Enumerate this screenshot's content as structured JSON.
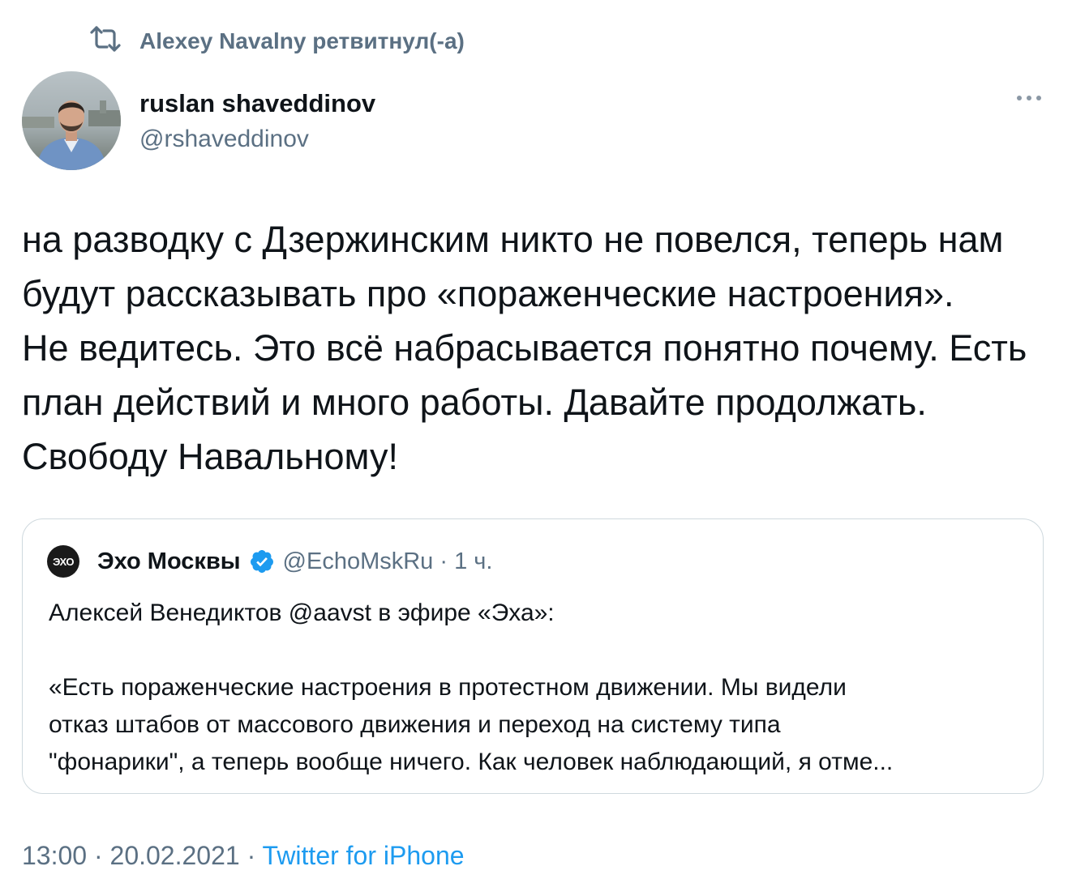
{
  "retweet": {
    "text": "Alexey Navalny ретвитнул(-а)"
  },
  "author": {
    "name": "ruslan shaveddinov",
    "handle": "@rshaveddinov"
  },
  "tweet": {
    "lines": [
      "на разводку с Дзержинским никто не повелся, теперь нам",
      "будут рассказывать про «пораженческие настроения».",
      "Не ведитесь. Это всё набрасывается понятно почему. Есть",
      "план действий и много работы. Давайте продолжать.",
      "Свободу Навальному!"
    ]
  },
  "quote": {
    "logo_text": "ЭХО",
    "name": "Эхо Москвы",
    "handle": "@EchoMskRu",
    "separator": "·",
    "time": "1 ч.",
    "first_line": "Алексей Венедиктов @aavst в эфире «Эха»:",
    "lines": [
      "«Есть пораженческие настроения в протестном движении. Мы видели",
      "отказ штабов от массового движения и переход на систему типа",
      "\"фонарики\", а теперь вообще ничего. Как человек наблюдающий, я отме..."
    ]
  },
  "meta": {
    "time": "13:00",
    "separator": "·",
    "date": "20.02.2021",
    "source": "Twitter for iPhone"
  },
  "colors": {
    "secondary": "#5b7083",
    "link": "#1d9bf0",
    "verified": "#1d9bf0",
    "border": "#cfd9de"
  },
  "icons": [
    "retweet-icon",
    "more-icon",
    "verified-icon"
  ]
}
